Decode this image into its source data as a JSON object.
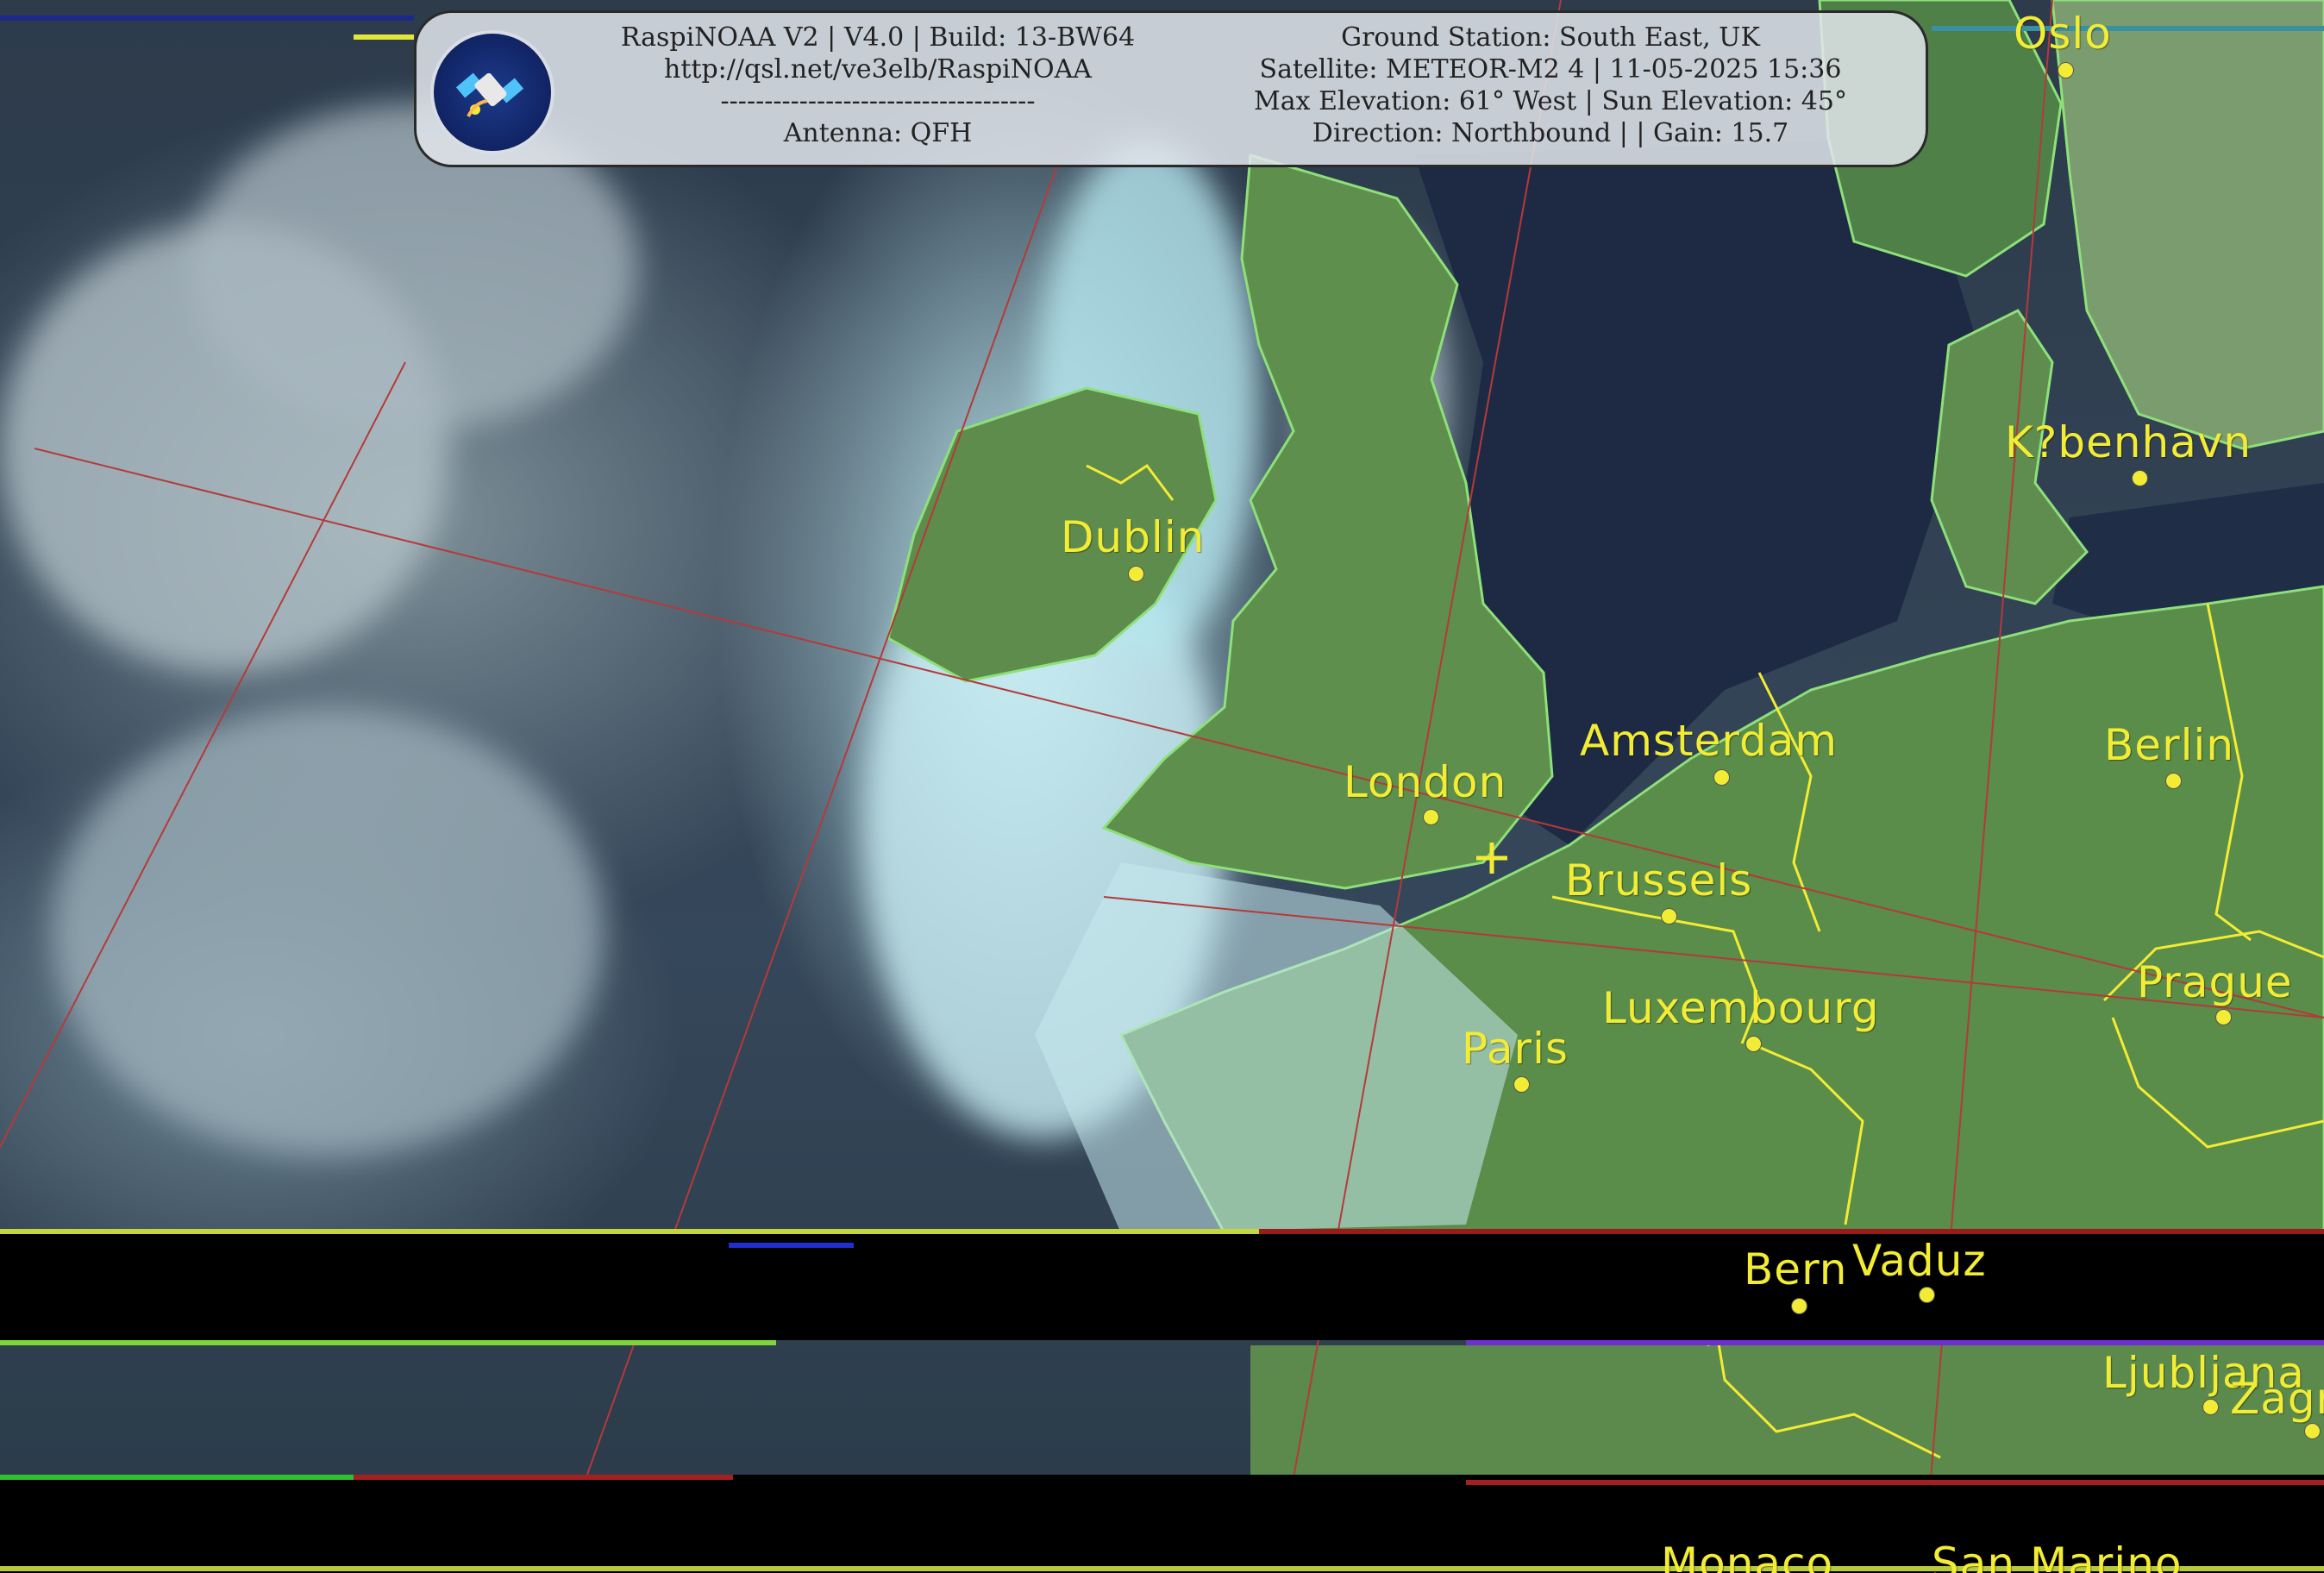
{
  "header": {
    "line1_left": "RaspiNOAA V2 | V4.0 | Build: 13-BW64",
    "line2_left": "http://qsl.net/ve3elb/RaspiNOAA",
    "line3_left": "------------------------------------",
    "line4_left": "Antenna: QFH",
    "line1_right": "Ground Station: South East, UK",
    "line2_right": "Satellite: METEOR-M2 4 | 11-05-2025 15:36",
    "line3_right": "Max Elevation: 61° West | Sun Elevation: 45°",
    "line4_right": "Direction: Northbound | | Gain: 15.7"
  },
  "logo": {
    "icon": "satellite-icon",
    "accent": "#1d3b8a"
  },
  "colors": {
    "city_label": "#f3ec34",
    "coastline": "#8ee07a",
    "border": "#f3ec34",
    "graticule": "#b43a3a",
    "land": "#5c8c4a",
    "sea": "#1e2a44"
  },
  "cities": [
    {
      "id": "oslo",
      "name": "Oslo"
    },
    {
      "id": "kobenhavn",
      "name": "K?benhavn"
    },
    {
      "id": "dublin",
      "name": "Dublin"
    },
    {
      "id": "amsterdam",
      "name": "Amsterdam"
    },
    {
      "id": "berlin",
      "name": "Berlin"
    },
    {
      "id": "london",
      "name": "London"
    },
    {
      "id": "brussels",
      "name": "Brussels"
    },
    {
      "id": "prague",
      "name": "Prague"
    },
    {
      "id": "luxembourg",
      "name": "Luxembourg"
    },
    {
      "id": "paris",
      "name": "Paris"
    },
    {
      "id": "bern",
      "name": "Bern"
    },
    {
      "id": "vaduz",
      "name": "Vaduz"
    },
    {
      "id": "ljubljana",
      "name": "Ljubljana"
    },
    {
      "id": "zagreb",
      "name": "Zagr"
    },
    {
      "id": "monaco",
      "name": "Monaco"
    },
    {
      "id": "sanmarino",
      "name": "San Marino"
    }
  ],
  "ground_station_marker": "crosshair-icon"
}
